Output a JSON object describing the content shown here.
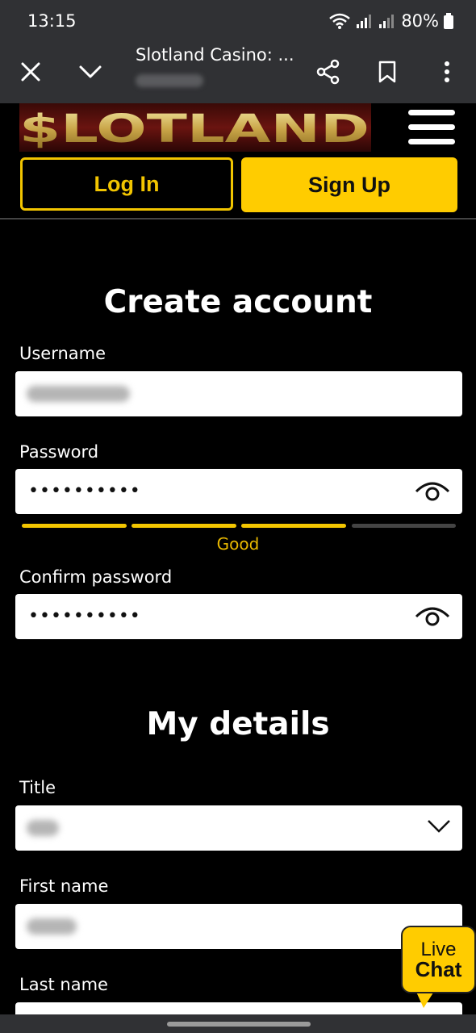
{
  "status_bar": {
    "time": "13:15",
    "battery": "80%"
  },
  "browser": {
    "page_title": "Slotland Casino: ...",
    "close_icon": "close-icon",
    "collapse_icon": "chevron-down-icon",
    "share_icon": "share-icon",
    "bookmark_icon": "bookmark-icon",
    "menu_icon": "more-vert-icon"
  },
  "header": {
    "logo_text": "$LOTLAND",
    "login_label": "Log In",
    "signup_label": "Sign Up"
  },
  "create_account": {
    "heading": "Create account",
    "username_label": "Username",
    "password_label": "Password",
    "password_value": "••••••••••",
    "strength_label": "Good",
    "strength_level": 0.75,
    "confirm_label": "Confirm password",
    "confirm_value": "••••••••••"
  },
  "my_details": {
    "heading": "My details",
    "title_label": "Title",
    "first_name_label": "First name",
    "last_name_label": "Last name"
  },
  "live_chat": {
    "line1": "Live",
    "line2": "Chat"
  },
  "colors": {
    "accent": "#ffcc00",
    "strength_filled": "#f2c500",
    "strength_empty": "#444444",
    "browser_bar": "#303134"
  }
}
